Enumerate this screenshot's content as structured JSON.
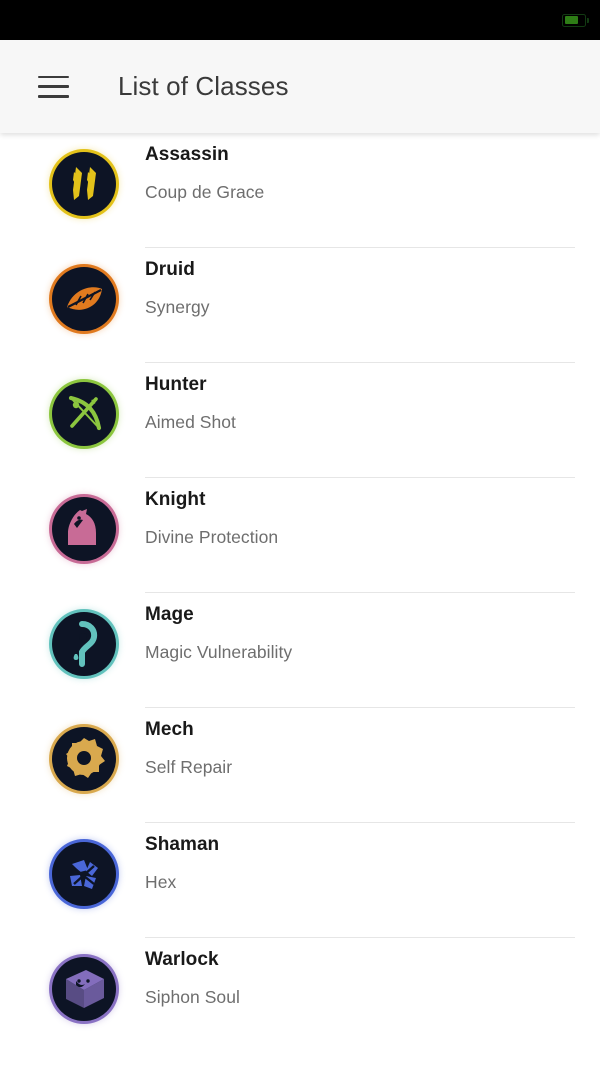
{
  "status_bar": {
    "battery_icon": "battery-icon",
    "battery_level_percent": 72
  },
  "app_bar": {
    "menu_icon": "hamburger-menu-icon",
    "title": "List of Classes"
  },
  "list": {
    "items": [
      {
        "name": "Assassin",
        "ability": "Coup de Grace",
        "icon": "dagger-icon",
        "accent": "#e3c21a",
        "bg": "#0d1425"
      },
      {
        "name": "Druid",
        "ability": "Synergy",
        "icon": "leaf-icon",
        "accent": "#e07a1f",
        "bg": "#0d1425"
      },
      {
        "name": "Hunter",
        "ability": "Aimed Shot",
        "icon": "bow-icon",
        "accent": "#8cc63f",
        "bg": "#0d1425"
      },
      {
        "name": "Knight",
        "ability": "Divine Protection",
        "icon": "chess-knight-icon",
        "accent": "#c86b96",
        "bg": "#0d1425"
      },
      {
        "name": "Mage",
        "ability": "Magic Vulnerability",
        "icon": "rune-icon",
        "accent": "#62c2bd",
        "bg": "#0d1425"
      },
      {
        "name": "Mech",
        "ability": "Self Repair",
        "icon": "gear-icon",
        "accent": "#d9a94e",
        "bg": "#0d1425"
      },
      {
        "name": "Shaman",
        "ability": "Hex",
        "icon": "totem-icon",
        "accent": "#4a67d8",
        "bg": "#0d1425"
      },
      {
        "name": "Warlock",
        "ability": "Siphon Soul",
        "icon": "grimoire-icon",
        "accent": "#8a72c4",
        "bg": "#0d1425"
      }
    ]
  }
}
